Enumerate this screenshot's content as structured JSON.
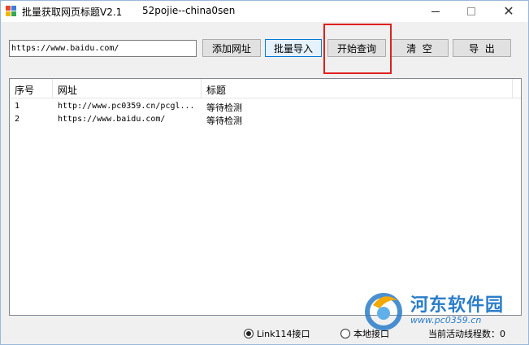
{
  "window": {
    "title": "批量获取网页标题V2.1",
    "credit": "52pojie--china0sen"
  },
  "toolbar": {
    "url_value": "https://www.baidu.com/",
    "add_label": "添加网址",
    "import_label": "批量导入",
    "query_label": "开始查询",
    "clear_label": "清  空",
    "export_label": "导  出"
  },
  "table": {
    "columns": [
      "序号",
      "网址",
      "标题"
    ],
    "rows": [
      {
        "no": "1",
        "url": "http://www.pc0359.cn/pcgl...",
        "title": "等待检测"
      },
      {
        "no": "2",
        "url": "https://www.baidu.com/",
        "title": "等待检测"
      }
    ]
  },
  "status": {
    "radio_link": "Link114接口",
    "radio_local": "本地接口",
    "thread_count": "当前活动线程数：0"
  },
  "watermark": {
    "name": "河东软件园",
    "url": "www.pc0359.cn"
  },
  "colors": {
    "highlight": "#e02020",
    "accent": "#0078d7",
    "watermark": "#2a7dc8"
  }
}
